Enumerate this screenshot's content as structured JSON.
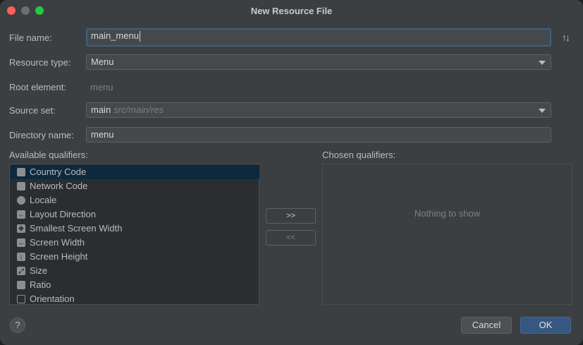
{
  "window": {
    "title": "New Resource File"
  },
  "form": {
    "file_name_label": "File name:",
    "file_name_value": "main_menu",
    "resource_type_label": "Resource type:",
    "resource_type_value": "Menu",
    "root_element_label": "Root element:",
    "root_element_value": "menu",
    "source_set_label": "Source set:",
    "source_set_value": "main",
    "source_set_hint": "src/main/res",
    "directory_name_label": "Directory name:",
    "directory_name_value": "menu"
  },
  "qualifiers": {
    "available_label": "Available qualifiers:",
    "chosen_label": "Chosen qualifiers:",
    "empty_text": "Nothing to show",
    "add_button": ">>",
    "remove_button": "<<",
    "items": [
      {
        "label": "Country Code",
        "icon": "country-code-icon"
      },
      {
        "label": "Network Code",
        "icon": "network-code-icon"
      },
      {
        "label": "Locale",
        "icon": "globe-icon"
      },
      {
        "label": "Layout Direction",
        "icon": "layout-direction-icon"
      },
      {
        "label": "Smallest Screen Width",
        "icon": "smallest-width-icon"
      },
      {
        "label": "Screen Width",
        "icon": "screen-width-icon"
      },
      {
        "label": "Screen Height",
        "icon": "screen-height-icon"
      },
      {
        "label": "Size",
        "icon": "size-icon"
      },
      {
        "label": "Ratio",
        "icon": "ratio-icon"
      },
      {
        "label": "Orientation",
        "icon": "orientation-icon"
      }
    ]
  },
  "footer": {
    "help": "?",
    "cancel": "Cancel",
    "ok": "OK"
  },
  "colors": {
    "background": "#3c3f41",
    "selection": "#0d293e",
    "ok_button": "#365880",
    "focus_border": "#3d6185"
  }
}
